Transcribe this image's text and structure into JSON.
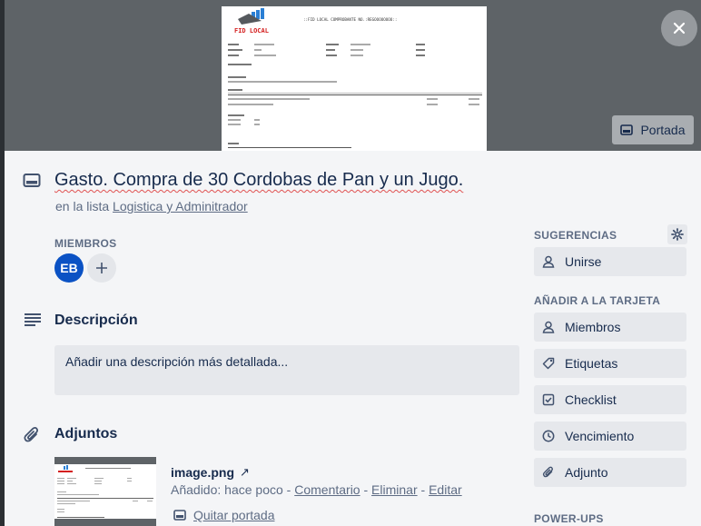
{
  "cover": {
    "button_label": "Portada",
    "doc_header": "::FID LOCAL COMPROBANTE NO.:REGOOOOOOOO::",
    "doc_logo": "FID LOCAL"
  },
  "card": {
    "title": "Gasto. Compra de 30 Cordobas de Pan y un Jugo.",
    "in_list_prefix": "en la lista",
    "list_name": "Logistica y Adminitrador"
  },
  "members": {
    "label": "MIEMBROS",
    "avatar_initials": "EB"
  },
  "description": {
    "title": "Descripción",
    "placeholder": "Añadir una descripción más detallada..."
  },
  "attachments": {
    "title": "Adjuntos",
    "file_name": "image.png",
    "ext_icon": "↗",
    "added_text": "Añadido: hace poco",
    "sep": " - ",
    "comment_link": "Comentario",
    "delete_link": "Eliminar",
    "edit_link": "Editar",
    "remove_cover": "Quitar portada"
  },
  "sidebar": {
    "suggestions_label": "SUGERENCIAS",
    "join_label": "Unirse",
    "add_to_card_label": "AÑADIR A LA TARJETA",
    "buttons": [
      {
        "label": "Miembros",
        "icon": "person-icon"
      },
      {
        "label": "Etiquetas",
        "icon": "tag-icon"
      },
      {
        "label": "Checklist",
        "icon": "checklist-icon"
      },
      {
        "label": "Vencimiento",
        "icon": "clock-icon"
      },
      {
        "label": "Adjunto",
        "icon": "paperclip-icon"
      }
    ],
    "powerups_label": "POWER-UPS"
  },
  "colors": {
    "avatar": "#0b52c4",
    "cover_bg": "#5e6367",
    "panel_bg": "#f4f5f7",
    "button_bg": "#e6e8ec"
  }
}
